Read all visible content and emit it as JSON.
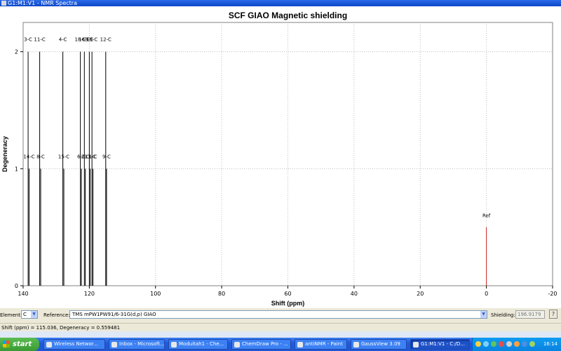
{
  "window": {
    "title": "G1:M1:V1 - NMR Spectra"
  },
  "chart_data": {
    "type": "bar",
    "title": "SCF GIAO Magnetic shielding",
    "xlabel": "Shift (ppm)",
    "ylabel": "Degeneracy",
    "xlim": [
      140,
      -20
    ],
    "ylim": [
      0,
      2.25
    ],
    "xticks": [
      140,
      120,
      100,
      80,
      60,
      40,
      20,
      0,
      -20
    ],
    "yticks": [
      0,
      1,
      2
    ],
    "grid": true,
    "peaks": [
      {
        "label": "3-C",
        "x": 138.5,
        "y": 2,
        "label2": null
      },
      {
        "label": "14-C",
        "x": 138.2,
        "y": 1,
        "label2": null
      },
      {
        "label": "11-C",
        "x": 135.0,
        "y": 2,
        "label2": null
      },
      {
        "label": "8-C",
        "x": 134.7,
        "y": 1,
        "label2": null
      },
      {
        "label": "4-C",
        "x": 128.0,
        "y": 2,
        "label2": null
      },
      {
        "label": "15-C",
        "x": 127.7,
        "y": 1,
        "label2": null
      },
      {
        "label": "18-C",
        "x": 122.7,
        "y": 2,
        "label2": null
      },
      {
        "label": "6-C",
        "x": 122.4,
        "y": 1,
        "label2": null
      },
      {
        "label": "16-C",
        "x": 121.5,
        "y": 2,
        "label2": null
      },
      {
        "label": "2-C",
        "x": 121.2,
        "y": 1,
        "label2": null
      },
      {
        "label": "5-C",
        "x": 120.0,
        "y": 2,
        "label2": null
      },
      {
        "label": "13-C",
        "x": 119.7,
        "y": 1,
        "label2": null
      },
      {
        "label": "19-C",
        "x": 119.2,
        "y": 2,
        "label2": null
      },
      {
        "label": "1-C",
        "x": 118.9,
        "y": 1,
        "label2": null
      },
      {
        "label": "12-C",
        "x": 115.036,
        "y": 2,
        "label2": null
      },
      {
        "label": "9-C",
        "x": 114.8,
        "y": 1,
        "label2": null
      },
      {
        "label": "Ref",
        "x": 0,
        "y": 0.5,
        "label2": null
      }
    ],
    "ref_color": "#cc2222",
    "peak_color": "#000000"
  },
  "controls": {
    "element_label": "Element:",
    "element_value": "C",
    "reference_label": "Reference:",
    "reference_value": "TMS mPW1PW91/6-31G(d,p) GIAO",
    "shielding_label": "Shielding:",
    "shielding_value": "196.9179",
    "help_label": "?"
  },
  "status": {
    "text": "Shift (ppm) = 115.036,  Degeneracy = 0.559481"
  },
  "taskbar": {
    "start_label": "start",
    "buttons": [
      {
        "label": "Wireless Networ..."
      },
      {
        "label": "Inbox - Microsoft..."
      },
      {
        "label": "Moduitah1 - Che..."
      },
      {
        "label": "ChemDraw Pro - ..."
      },
      {
        "label": "antiNMR - Paint"
      },
      {
        "label": "GaussView 3.09"
      },
      {
        "label": "G1:M1:V1 - C:/D..."
      }
    ],
    "clock": "16:14"
  }
}
